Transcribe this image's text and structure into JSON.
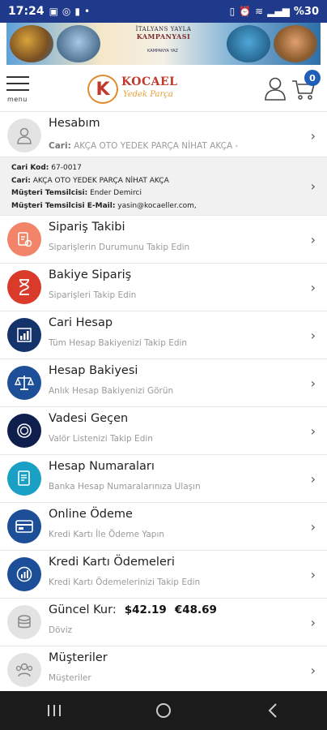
{
  "status_bar": {
    "time": "17:24",
    "battery": "%30"
  },
  "banner": {
    "line1": "İTALYANS YAYLA",
    "line2": "KAMPANYASI",
    "small": "KAMPANYA YAZ"
  },
  "header": {
    "menu_label": "menu",
    "logo_name": "KOCAEL",
    "logo_sub": "Yedek Parça",
    "logo_letter": "K",
    "cart_count": "0"
  },
  "account": {
    "title": "Hesabım",
    "cari_label": "Cari:",
    "cari_value": "AKÇA OTO YEDEK PARÇA NİHAT AKÇA -"
  },
  "cari_info": {
    "kod_label": "Cari Kod:",
    "kod_value": "67-0017",
    "cari_label": "Cari:",
    "cari_value": "AKÇA OTO YEDEK PARÇA NİHAT AKÇA",
    "rep_label": "Müşteri Temsilcisi:",
    "rep_value": "Ender Demirci",
    "email_label": "Müşteri Temsilcisi E-Mail:",
    "email_value": "yasin@kocaeller.com,"
  },
  "menu_items": [
    {
      "title": "Sipariş Takibi",
      "subtitle": "Siparişlerin Durumunu Takip Edin",
      "icon": "order-tracking-icon",
      "color": "#f2846a"
    },
    {
      "title": "Bakiye Sipariş",
      "subtitle": "Siparişleri Takip Edin",
      "icon": "hourglass-icon",
      "color": "#d93a2a"
    },
    {
      "title": "Cari Hesap",
      "subtitle": "Tüm Hesap Bakiyenizi Takip Edin",
      "icon": "bar-chart-icon",
      "color": "#14336b"
    },
    {
      "title": "Hesap Bakiyesi",
      "subtitle": "Anlık Hesap Bakiyenizi Görün",
      "icon": "scale-icon",
      "color": "#1d4f98"
    },
    {
      "title": "Vadesi Geçen",
      "subtitle": "Valör Listenizi Takip Edin",
      "icon": "coin-icon",
      "color": "#0f1f4d"
    },
    {
      "title": "Hesap Numaraları",
      "subtitle": "Banka Hesap Numaralarınıza Ulaşın",
      "icon": "bank-document-icon",
      "color": "#1aa0c4"
    },
    {
      "title": "Online Ödeme",
      "subtitle": "Kredi Kartı İle Ödeme Yapın",
      "icon": "credit-card-icon",
      "color": "#1d4f98"
    },
    {
      "title": "Kredi Kartı Ödemeleri",
      "subtitle": "Kredi Kartı Ödemelerinizi Takip Edin",
      "icon": "payment-chart-icon",
      "color": "#1d4f98"
    }
  ],
  "currency": {
    "title": "Güncel Kur:",
    "usd": "$42.19",
    "eur": "€48.69",
    "subtitle": "Döviz"
  },
  "customers": {
    "title": "Müşteriler",
    "subtitle": "Müşteriler"
  }
}
